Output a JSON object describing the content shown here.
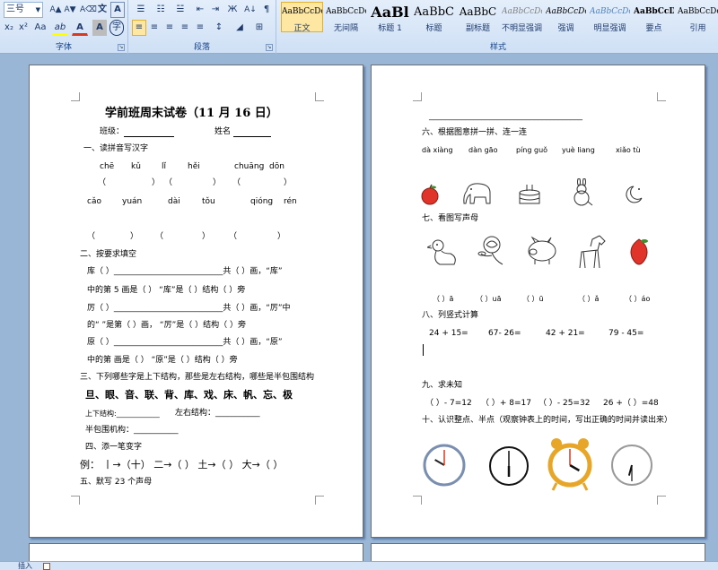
{
  "ribbon": {
    "font_size_value": "三号",
    "grow_font_icon": "A▲",
    "shrink_font_icon": "A▼",
    "clear_format_icon": "A⌫",
    "char_border_icon": "文",
    "char_shading_icon": "A",
    "subscript": "x₂",
    "superscript": "x²",
    "change_case": "Aa",
    "highlight": "ab",
    "font_color": "A",
    "char_scale": "A",
    "encircle": "字",
    "font_group_label": "字体",
    "paragraph_group_label": "段落",
    "styles_group_label": "样式",
    "bullets_icon": "☰",
    "numbering_icon": "☷",
    "multilevel_icon": "☱",
    "decrease_indent_icon": "⇤",
    "increase_indent_icon": "⇥",
    "chinese_layout_icon": "Ж",
    "sort_icon": "A↓",
    "show_marks_icon": "¶",
    "align_left_icon": "≡",
    "center_icon": "≡",
    "align_right_icon": "≡",
    "justify_icon": "≡",
    "distributed_icon": "≡",
    "line_spacing_icon": "↕",
    "shading_icon": "◢",
    "borders_icon": "⊞",
    "launcher_icon": "↘"
  },
  "styles": [
    {
      "sample": "AaBbCcDc",
      "name": "正文",
      "color": "#000000"
    },
    {
      "sample": "AaBbCcDc",
      "name": "无间隔",
      "color": "#000000"
    },
    {
      "sample": "AaBl",
      "name": "标题 1",
      "color": "#000000"
    },
    {
      "sample": "AaBbC",
      "name": "标题",
      "color": "#000000"
    },
    {
      "sample": "AaBbC",
      "name": "副标题",
      "color": "#000000"
    },
    {
      "sample": "AaBbCcDc",
      "name": "不明显强调",
      "color": "#808080"
    },
    {
      "sample": "AaBbCcDc",
      "name": "强调",
      "color": "#000000"
    },
    {
      "sample": "AaBbCcDc",
      "name": "明显强调",
      "color": "#4f81bd"
    },
    {
      "sample": "AaBbCcD",
      "name": "要点",
      "color": "#000000"
    },
    {
      "sample": "AaBbCcDc",
      "name": "引用",
      "color": "#000000"
    }
  ],
  "page1": {
    "title": "学前班周末试卷（11 月 16 日）",
    "class_label": "班级：",
    "name_label": "姓名",
    "s1_heading": "一、读拼音写汉字",
    "pinyin_row1": [
      "chē",
      "kǔ",
      "lǐ",
      "hěi",
      "chuāng",
      "dōn"
    ],
    "paren_row1": [
      "（",
      "）",
      "（",
      "）",
      "（",
      "）"
    ],
    "pinyin_row2": [
      "cǎo",
      "yuán",
      "dài",
      "tǒu",
      "qióng",
      "rén"
    ],
    "paren_row2": [
      "（",
      "）",
      "（",
      "）",
      "（",
      "）"
    ],
    "s2_heading": "二、按要求填空",
    "lines": [
      "库（    ）___________________________共（  ）画，“库”",
      "中的第 5 画是（    ）  “库”是（  ）结构（    ）旁",
      "厉（    ）___________________________共（  ）画，“厉”中",
      "的“ ”是第（    ）画，  “厉”是（  ）结构（    ）旁",
      "原（    ）___________________________共（  ）画，“原”",
      "中的第  画是（    ）    “原”是（  ）结构（    ）旁"
    ],
    "s3_heading": "三、下列哪些字是上下结构，那些是左右结构，哪些是半包围结构",
    "s3_chars": "旦、眼、音、联、背、库、戏、床、帆、忘、极",
    "updown_label": "上下结构:____________",
    "leftright_label": "左右结构：___________",
    "semi_label": "半包围机构：___________",
    "s4_heading": "四、添一笔变字",
    "s4_line": "例： 丨→（十）    二→（  ）    土→（  ）    大→（  ）",
    "s5_heading": "五、默写 23 个声母"
  },
  "page2": {
    "top_rule": "______________________________________",
    "s6_heading": "六、根据图意拼一拼、连一连",
    "s6_pinyin": [
      "dà  xiàng",
      "dàn  gāo",
      "píng guǒ",
      "yuè  liang",
      "xiǎo  tù"
    ],
    "s6_images": [
      "苹果",
      "大象",
      "蛋糕",
      "兔子",
      "月亮"
    ],
    "s7_heading": "七、看图写声母",
    "s7_images": [
      "鸭子",
      "玫瑰",
      "猪",
      "马",
      "桃子"
    ],
    "s7_answers": [
      "（ ）ā",
      "（ ）uā",
      "（ ）ū",
      "（ ）ǎ",
      "（ ）áo"
    ],
    "s8_heading": "八、列竖式计算",
    "s8_problems": [
      "24 + 15=",
      "67- 26=",
      "42 + 21=",
      "79 - 45="
    ],
    "s9_heading": "九、求未知",
    "s9_problems": [
      "（  ）- 7=12",
      "（  ）+ 8=17",
      "（  ）- 25=32",
      "26 +（  ）=48"
    ],
    "s10_heading": "十、认识整点、半点（观察钟表上的时间，写出正确的时间并读出来）",
    "clocks": [
      {
        "hour": 10,
        "minute": 0
      },
      {
        "hour": 6,
        "minute": 0
      },
      {
        "hour": 4,
        "minute": 0
      },
      {
        "hour": 6,
        "minute": 30
      }
    ]
  },
  "status": {
    "insert_label": "插入"
  },
  "colors": {
    "accent": "#15428b",
    "workspace": "#9ab6d6",
    "selected_style": "#fde7a3",
    "red": "#d93a1f"
  }
}
